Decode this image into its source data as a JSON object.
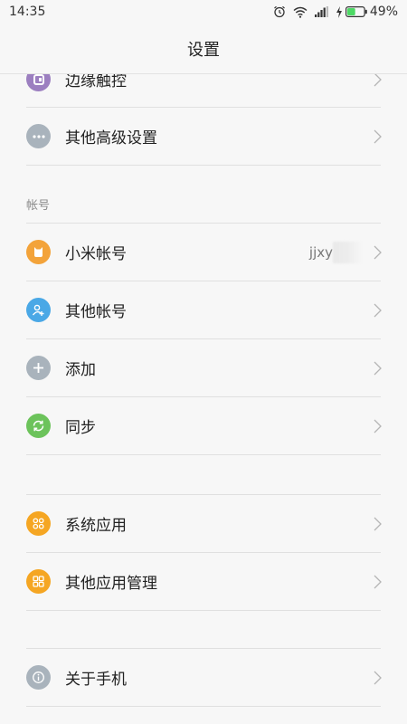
{
  "status_bar": {
    "time": "14:35",
    "battery_percent": "49%",
    "battery_level": 0.49
  },
  "title": "设置",
  "sections": {
    "top_rows": [
      {
        "label": "边缘触控",
        "icon": "edge-touch-icon",
        "color": "#9c7fc0"
      },
      {
        "label": "其他高级设置",
        "icon": "more-dots-icon",
        "color": "#a9b3bc"
      }
    ],
    "account_header": "帐号",
    "account_rows": [
      {
        "label": "小米帐号",
        "icon": "mi-account-icon",
        "color": "#f3a33a",
        "value": "jjxy"
      },
      {
        "label": "其他帐号",
        "icon": "person-add-icon",
        "color": "#4aa8e6"
      },
      {
        "label": "添加",
        "icon": "plus-icon",
        "color": "#a9b3bc"
      },
      {
        "label": "同步",
        "icon": "sync-icon",
        "color": "#6cc35b"
      }
    ],
    "app_rows": [
      {
        "label": "系统应用",
        "icon": "apps-grid-icon",
        "color": "#f5a623"
      },
      {
        "label": "其他应用管理",
        "icon": "apps-grid-icon",
        "color": "#f5a623"
      }
    ],
    "about_rows": [
      {
        "label": "关于手机",
        "icon": "info-icon",
        "color": "#a9b3bc"
      }
    ]
  }
}
